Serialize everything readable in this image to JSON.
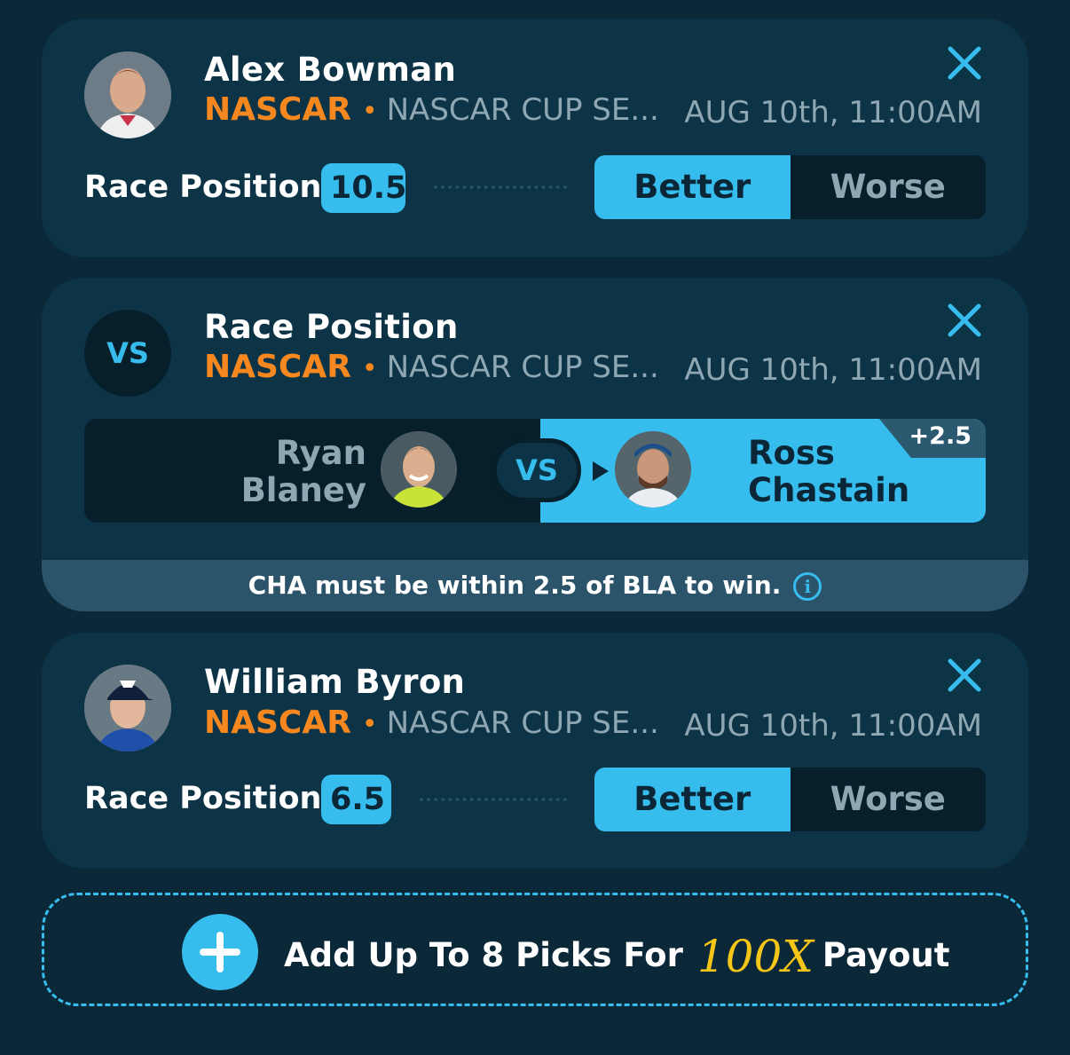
{
  "picks": [
    {
      "player_name": "Alex Bowman",
      "league": "NASCAR",
      "separator": "•",
      "series": "NASCAR CUP SE...",
      "date": "AUG 10th, 11:00AM",
      "stat_label": "Race Position:",
      "stat_value": "10.5",
      "better_label": "Better",
      "worse_label": "Worse"
    },
    {
      "title": "Race Position",
      "vs_label": "VS",
      "league": "NASCAR",
      "separator": "•",
      "series": "NASCAR CUP SE...",
      "date": "AUG 10th, 11:00AM",
      "left_player": {
        "first": "Ryan",
        "last": "Blaney"
      },
      "right_player": {
        "first": "Ross",
        "last": "Chastain"
      },
      "handicap": "+2.5",
      "note": "CHA must be within 2.5 of BLA to win."
    },
    {
      "player_name": "William Byron",
      "league": "NASCAR",
      "separator": "•",
      "series": "NASCAR CUP SE...",
      "date": "AUG 10th, 11:00AM",
      "stat_label": "Race Position:",
      "stat_value": "6.5",
      "better_label": "Better",
      "worse_label": "Worse"
    }
  ],
  "add_picks": {
    "text_before": "Add Up To 8 Picks For",
    "multiplier": "100X",
    "text_after": "Payout"
  },
  "colors": {
    "background": "#0a2838",
    "card": "#0c3446",
    "accent_blue": "#36bdee",
    "league_orange": "#f7881f",
    "muted_text": "#8fa7b3",
    "multiplier_gold": "#f5c518"
  }
}
